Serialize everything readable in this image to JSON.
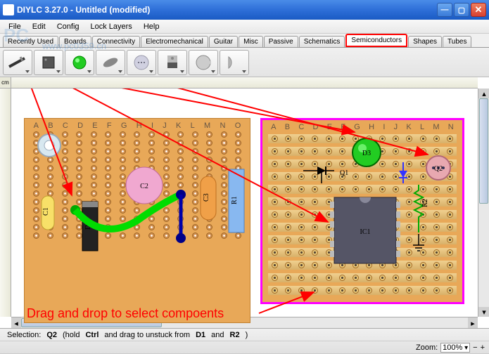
{
  "window": {
    "title": "DIYLC 3.27.0 - Untitled (modified)"
  },
  "menu": {
    "items": [
      "File",
      "Edit",
      "Config",
      "Lock Layers",
      "Help"
    ]
  },
  "watermark": {
    "logo": "PC",
    "url": "www.pc0359.cn"
  },
  "tabs": {
    "items": [
      "Recently Used",
      "Boards",
      "Connectivity",
      "Electromechanical",
      "Guitar",
      "Misc",
      "Passive",
      "Schematics",
      "Semiconductors",
      "Shapes",
      "Tubes"
    ],
    "active": "Semiconductors"
  },
  "toolbar": {
    "tools": [
      {
        "name": "diode-tool",
        "icon": "diode"
      },
      {
        "name": "ic-tool",
        "icon": "ic"
      },
      {
        "name": "led-tool",
        "icon": "led"
      },
      {
        "name": "resistor-tool",
        "icon": "resistor"
      },
      {
        "name": "transistor-to92-tool",
        "icon": "to92"
      },
      {
        "name": "transistor-to220-tool",
        "icon": "to220"
      },
      {
        "name": "transistor-round-tool",
        "icon": "round"
      },
      {
        "name": "transistor-half-tool",
        "icon": "half"
      }
    ]
  },
  "ruler": {
    "unit": "cm"
  },
  "board1": {
    "columns": [
      "A",
      "B",
      "C",
      "D",
      "E",
      "F",
      "G",
      "H",
      "I",
      "J",
      "K",
      "L",
      "M",
      "N",
      "O"
    ],
    "components": {
      "c1": "C1",
      "c2": "C2",
      "c3": "C3",
      "d2": "D2",
      "r1": "R1"
    }
  },
  "board2": {
    "columns": [
      "A",
      "B",
      "C",
      "D",
      "E",
      "F",
      "G",
      "H",
      "I",
      "J",
      "K",
      "L",
      "M",
      "N"
    ],
    "components": {
      "d3": "D3",
      "q1": "Q1",
      "q2": "Q2",
      "ic1": "IC1",
      "r2": "R2"
    }
  },
  "annotation": {
    "text": "Drag and drop to select compoents"
  },
  "status": {
    "selection_label": "Selection:",
    "selection_value": "Q2",
    "hint1": "(hold",
    "ctrl": "Ctrl",
    "hint2": "and drag to unstuck from",
    "d1": "D1",
    "and": "and",
    "r2": "R2",
    "close": ")",
    "zoom_label": "Zoom:",
    "zoom_value": "100%"
  }
}
